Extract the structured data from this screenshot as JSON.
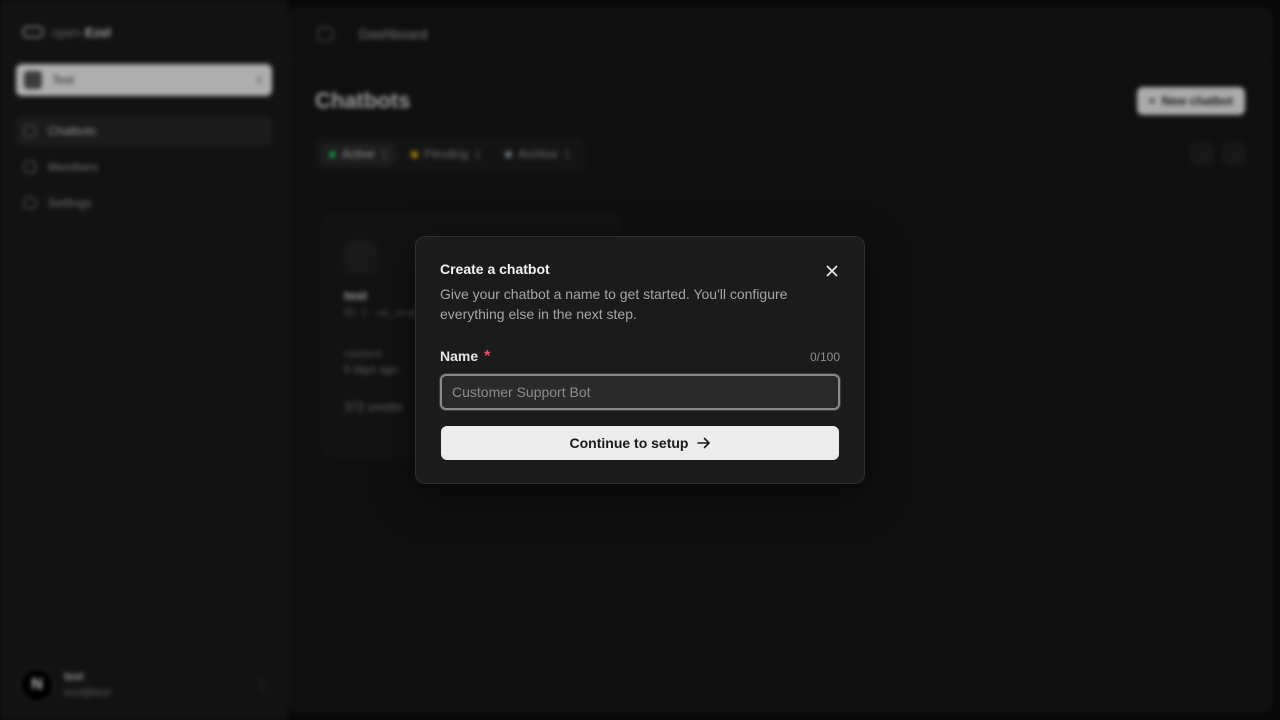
{
  "sidebar": {
    "brand_prefix": "open",
    "brand_name": "Ezel",
    "workspace_name": "Test",
    "items": [
      {
        "label": "Chatbots"
      },
      {
        "label": "Members"
      },
      {
        "label": "Settings"
      }
    ],
    "user": {
      "initial": "N",
      "name": "test",
      "email": "test@test"
    }
  },
  "topbar": {
    "title": "Dashboard"
  },
  "page": {
    "title": "Chatbots",
    "new_button": "New chatbot",
    "filters": [
      {
        "label": "Active",
        "count": "1",
        "color": "#22c55e"
      },
      {
        "label": "Pending",
        "count": "1",
        "color": "#eab308"
      },
      {
        "label": "Archive",
        "count": "1",
        "color": "#9ca3af"
      }
    ],
    "card": {
      "name": "test",
      "subtitle": "ID: 1 · no_avatar",
      "label": "Updated",
      "time": "5 days ago",
      "footer": "372 credits"
    }
  },
  "modal": {
    "title": "Create a chatbot",
    "description": "Give your chatbot a name to get started. You'll configure everything else in the next step.",
    "field_label": "Name",
    "required_mark": "*",
    "counter": "0/100",
    "placeholder": "Customer Support Bot",
    "value": "",
    "submit_label": "Continue to setup",
    "close_icon": "close-icon",
    "arrow_icon": "arrow-right-icon"
  }
}
